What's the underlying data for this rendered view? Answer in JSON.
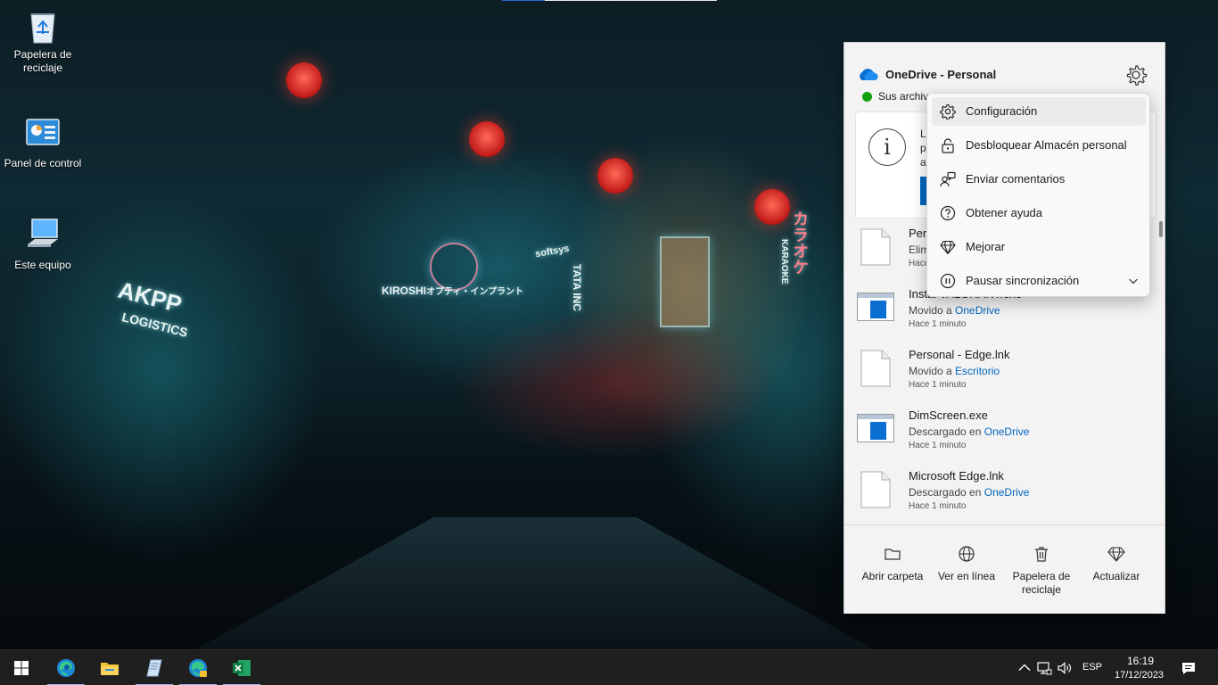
{
  "desktop": {
    "icons": [
      {
        "label": "Papelera de reciclaje",
        "icon": "recycle-bin-icon"
      },
      {
        "label": "Panel de control",
        "icon": "control-panel-icon"
      },
      {
        "label": "Este equipo",
        "icon": "computer-icon"
      }
    ],
    "wallpaper_signs": {
      "akpp": "AKPP",
      "logistics": "LOGISTICS",
      "kiroshi": "KIROSHI",
      "kiroshi_jp": "オプティ・インプラント",
      "softsys": "softsys",
      "tata": "TATA INC",
      "karaoke": "KARAOKE",
      "karaoke_jp": "カラオケ"
    }
  },
  "onedrive": {
    "title": "OneDrive - Personal",
    "status_text": "Sus archivos están sincronizados",
    "info_card": {
      "line1": "La",
      "line2": "pa",
      "line3": "ap"
    },
    "files": [
      {
        "name": "Pers",
        "action": "Elim",
        "location": "",
        "time": "Hace",
        "icon": "document-icon"
      },
      {
        "name": "Instal VALORANT.exe",
        "action": "Movido a",
        "location": "OneDrive",
        "time": "Hace 1 minuto",
        "icon": "exe-icon"
      },
      {
        "name": "Personal - Edge.lnk",
        "action": "Movido a",
        "location": "Escritorio",
        "time": "Hace 1 minuto",
        "icon": "document-icon"
      },
      {
        "name": "DimScreen.exe",
        "action": "Descargado en",
        "location": "OneDrive",
        "time": "Hace 1 minuto",
        "icon": "exe-icon"
      },
      {
        "name": "Microsoft Edge.lnk",
        "action": "Descargado en",
        "location": "OneDrive",
        "time": "Hace 1 minuto",
        "icon": "document-icon"
      }
    ],
    "footer": [
      {
        "label": "Abrir carpeta",
        "icon": "folder-icon"
      },
      {
        "label": "Ver en línea",
        "icon": "globe-icon"
      },
      {
        "label": "Papelera de reciclaje",
        "icon": "trash-icon"
      },
      {
        "label": "Actualizar",
        "icon": "diamond-icon"
      }
    ]
  },
  "context_menu": {
    "items": [
      {
        "label": "Configuración",
        "icon": "gear-icon"
      },
      {
        "label": "Desbloquear Almacén personal",
        "icon": "lock-icon"
      },
      {
        "label": "Enviar comentarios",
        "icon": "feedback-icon"
      },
      {
        "label": "Obtener ayuda",
        "icon": "help-icon"
      },
      {
        "label": "Mejorar",
        "icon": "diamond-icon"
      },
      {
        "label": "Pausar sincronización",
        "icon": "pause-icon"
      }
    ]
  },
  "taskbar": {
    "apps": [
      {
        "name": "start",
        "icon": "windows-start-icon"
      },
      {
        "name": "edge",
        "icon": "edge-icon"
      },
      {
        "name": "file-explorer",
        "icon": "folder-icon"
      },
      {
        "name": "notepad",
        "icon": "notepad-icon"
      },
      {
        "name": "edge-profile",
        "icon": "edge-profile-icon"
      },
      {
        "name": "excel",
        "icon": "excel-icon"
      }
    ],
    "language": "ESP",
    "time": "16:19",
    "date": "17/12/2023"
  },
  "colors": {
    "accent": "#0067c0",
    "flyout_bg": "#f3f3f3",
    "taskbar_bg": "#1f1f1f",
    "status_ok": "#13a10e"
  }
}
